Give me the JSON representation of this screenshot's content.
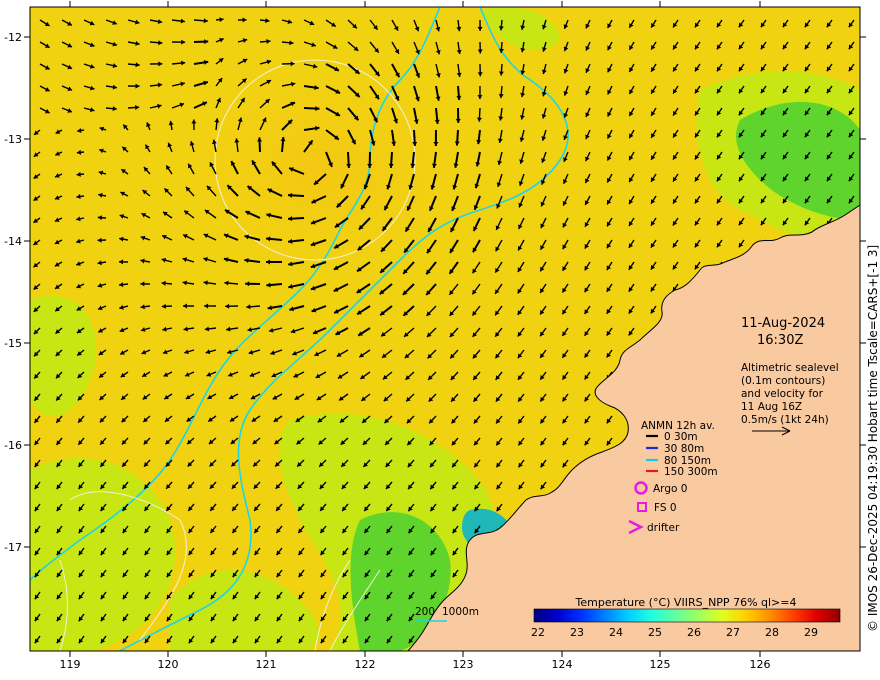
{
  "map": {
    "lat_ticks": [
      "-12",
      "-13",
      "-14",
      "-15",
      "-16",
      "-17"
    ],
    "lon_ticks": [
      "119",
      "120",
      "121",
      "122",
      "123",
      "124",
      "125",
      "126"
    ],
    "colors": {
      "land": "#f9c9a0",
      "sea_warm": "#f1d211",
      "sea_mid": "#c7e614",
      "sea_cool": "#5fd42c",
      "sea_cold": "#17b25e",
      "estuary": "#1fb7b7",
      "coast": "#000000",
      "isobath": "#19d6e8",
      "contour": "#f2f2d8"
    }
  },
  "info": {
    "date": "11-Aug-2024",
    "time": "16:30Z",
    "desc_lines": [
      "Altimetric sealevel",
      "(0.1m contours)",
      "and velocity for",
      "11 Aug 16Z",
      "0.5m/s (1kt 24h)"
    ]
  },
  "legend": {
    "title": "ANMN 12h av.",
    "items": [
      {
        "label": "0 30m",
        "color": "#000000"
      },
      {
        "label": "30 80m",
        "color": "#1e2bd6"
      },
      {
        "label": "80 150m",
        "color": "#19c9e0"
      },
      {
        "label": "150 300m",
        "color": "#e01b1b"
      }
    ],
    "argo": "Argo 0",
    "fs": "FS 0",
    "drifter": "drifter",
    "marker_color": "#e41ce4"
  },
  "isobath_label": {
    "a": "200",
    "b": "1000m"
  },
  "colorbar": {
    "title": "Temperature (°C) VIIRS_NPP 76% ql>=4",
    "ticks": [
      "22",
      "23",
      "24",
      "25",
      "26",
      "27",
      "28",
      "29"
    ],
    "colors": [
      "#00007f",
      "#0000d0",
      "#0030ff",
      "#0080ff",
      "#00d0ff",
      "#20ffdf",
      "#60ff9f",
      "#9fff60",
      "#dfff20",
      "#ffd000",
      "#ff9000",
      "#ff4000",
      "#e00000",
      "#900000"
    ]
  },
  "side_label": "© IMOS 26-Dec-2025 04:19:30 Hobart time Tscale=CARS+[-1 3]"
}
